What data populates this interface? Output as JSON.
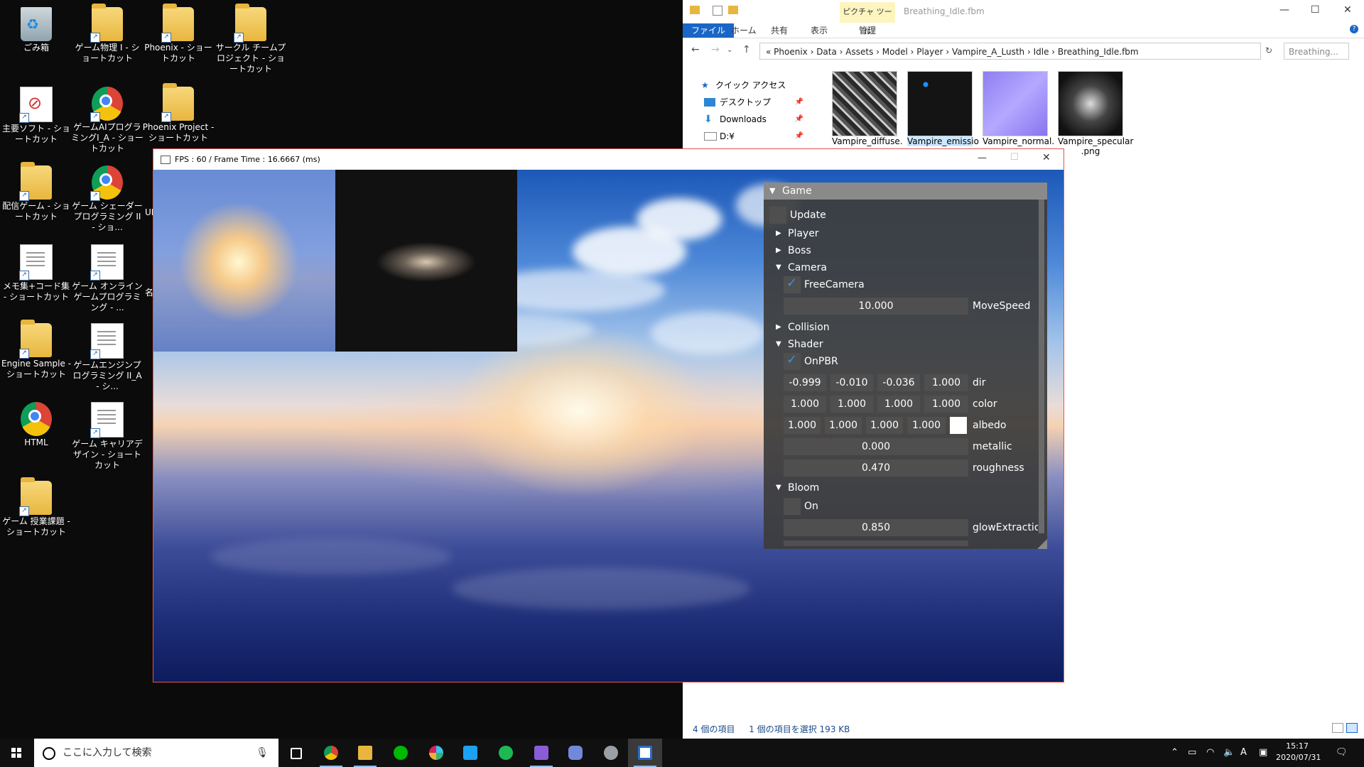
{
  "desktop": {
    "icons": [
      {
        "label": "ごみ箱"
      },
      {
        "label": "ゲーム物理 I - ショートカット"
      },
      {
        "label": "Phoenix - ショートカット"
      },
      {
        "label": "サークル チームプロジェクト - ショートカット"
      },
      {
        "label": "主要ソフト - ショートカット"
      },
      {
        "label": "ゲームAIプログラミングI_A - ショートカット"
      },
      {
        "label": "Phoenix Project - ショートカット"
      },
      {
        "label": "配信ゲーム - ショートカット"
      },
      {
        "label": "ゲーム シェーダープログラミング II - ショ..."
      },
      {
        "label": "メモ集+コード集 - ショートカット"
      },
      {
        "label": "ゲーム オンラインゲームプログラミング - ..."
      },
      {
        "label": "Engine Sample - ショートカット"
      },
      {
        "label": "ゲームエンジンプログラミング II_A - シ..."
      },
      {
        "label": "HTML"
      },
      {
        "label": "ゲーム キャリアデザイン - ショートカット"
      },
      {
        "label": "ゲーム 授業課題 - ショートカット"
      }
    ],
    "partial_labels": [
      "UE",
      "名"
    ]
  },
  "explorer": {
    "title": "Breathing_Idle.fbm",
    "context_tab": "ピクチャ ツール",
    "context_sub": "管理",
    "ribbon_tabs": [
      "ファイル",
      "ホーム",
      "共有",
      "表示"
    ],
    "address": "«  Phoenix  ›  Data  ›  Assets  ›  Model  ›  Player  ›  Vampire_A_Lusth  ›  Idle  ›  Breathing_Idle.fbm",
    "search_placeholder": "Breathing...",
    "nav": [
      {
        "label": "クイック アクセス"
      },
      {
        "label": "デスクトップ"
      },
      {
        "label": "Downloads"
      },
      {
        "label": "D:¥"
      }
    ],
    "files": [
      {
        "name": "Vampire_diffuse."
      },
      {
        "name": "Vampire_emissio"
      },
      {
        "name": "Vampire_normal."
      },
      {
        "name": "Vampire_specular .png"
      }
    ],
    "status_items": "4 個の項目",
    "status_selected": "1 個の項目を選択  193 KB"
  },
  "game": {
    "title": "FPS : 60 / Frame Time : 16.6667 (ms)",
    "panel": {
      "title": "Game",
      "update_label": "Update",
      "tree": {
        "player": "Player",
        "boss": "Boss",
        "camera": "Camera",
        "collision": "Collision",
        "shader": "Shader",
        "bloom": "Bloom"
      },
      "free_camera": "FreeCamera",
      "move_speed": {
        "value": "10.000",
        "label": "MoveSpeed"
      },
      "on_pbr": "OnPBR",
      "dir": {
        "values": [
          "-0.999",
          "-0.010",
          "-0.036",
          "1.000"
        ],
        "label": "dir"
      },
      "color": {
        "values": [
          "1.000",
          "1.000",
          "1.000",
          "1.000"
        ],
        "label": "color"
      },
      "albedo": {
        "values": [
          "1.000",
          "1.000",
          "1.000",
          "1.000"
        ],
        "label": "albedo"
      },
      "metallic": {
        "value": "0.000",
        "label": "metallic"
      },
      "roughness": {
        "value": "0.470",
        "label": "roughness"
      },
      "bloom_on": "On",
      "glow": {
        "value": "0.850",
        "label": "glowExtraction"
      }
    }
  },
  "taskbar": {
    "search_placeholder": "ここに入力して検索",
    "time": "15:17",
    "date": "2020/07/31",
    "ime": "A"
  }
}
